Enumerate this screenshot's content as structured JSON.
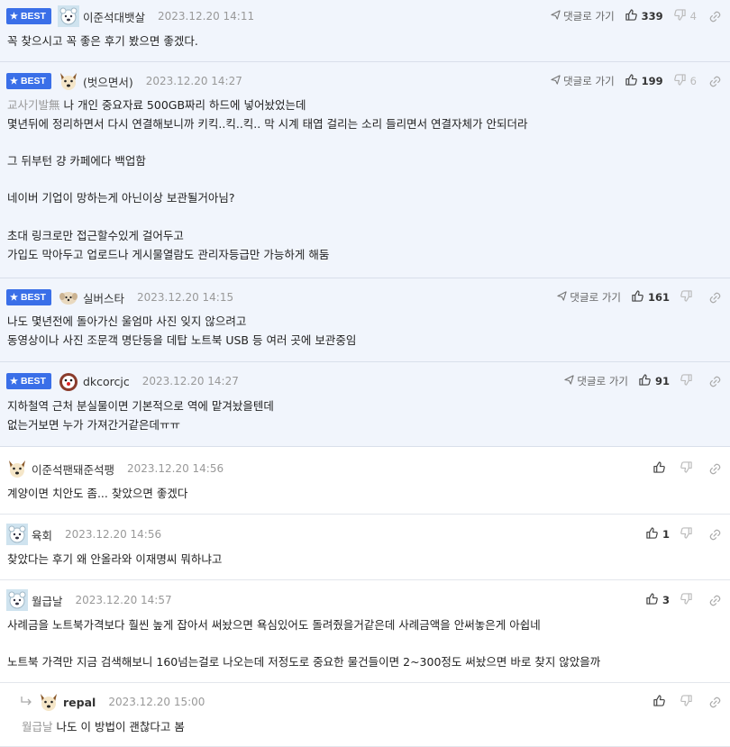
{
  "labels": {
    "best": "BEST",
    "reply": "댓글로 가기"
  },
  "colors": {
    "accent": "#3a6fe8",
    "best_bg": "#f1f5fc"
  },
  "comments": [
    {
      "best": true,
      "avatar": "polar-bear",
      "nick": "이준석대뱃살",
      "bold_nick": false,
      "date": "2023.12.20 14:11",
      "show_reply": true,
      "up": "339",
      "down": "4",
      "lines": [
        "꼭 찾으시고 꼭 좋은 후기 봤으면 좋겠다."
      ]
    },
    {
      "best": true,
      "avatar": "dog",
      "nick": "(벗으면서)",
      "bold_nick": false,
      "date": "2023.12.20 14:27",
      "show_reply": true,
      "up": "199",
      "down": "6",
      "mention": "교사기발無",
      "lines": [
        "나 개인 중요자료 500GB짜리 하드에 넣어놨었는데",
        "몇년뒤에 정리하면서 다시 연결해보니까 키킥..킥..킥.. 막 시계 태엽 걸리는 소리 들리면서 연결자체가 안되더라",
        "",
        "그 뒤부턴 걍 카페에다 백업함",
        "",
        "네이버 기업이 망하는게 아닌이상 보관될거아님?",
        "",
        "초대 링크로만 접근할수있게 걸어두고",
        "가입도 막아두고 업로드나 게시물열람도 관리자등급만 가능하게 해둠"
      ]
    },
    {
      "best": true,
      "avatar": "puppy",
      "nick": "실버스타",
      "bold_nick": false,
      "date": "2023.12.20 14:15",
      "show_reply": true,
      "up": "161",
      "down": "",
      "lines": [
        "나도 몇년전에 돌아가신 울엄마 사진 잊지 않으려고",
        "동영상이나 사진 조문객 명단등을 데탑 노트북 USB 등 여러 곳에 보관중임"
      ]
    },
    {
      "best": true,
      "avatar": "clown",
      "nick": "dkcorcjc",
      "bold_nick": false,
      "date": "2023.12.20 14:27",
      "show_reply": true,
      "up": "91",
      "down": "",
      "lines": [
        "지하철역 근처 분실물이면 기본적으로 역에 맡겨놨을텐데",
        "없는거보면 누가 가져간거같은데ㅠㅠ"
      ]
    },
    {
      "best": false,
      "avatar": "dog",
      "nick": "이준석팬돼준석팽",
      "bold_nick": false,
      "date": "2023.12.20 14:56",
      "show_reply": false,
      "up": "",
      "down": "",
      "lines": [
        "계양이면 치안도 좀... 찾았으면 좋겠다"
      ]
    },
    {
      "best": false,
      "avatar": "polar-bear",
      "nick": "육회",
      "bold_nick": false,
      "date": "2023.12.20 14:56",
      "show_reply": false,
      "up": "1",
      "down": "",
      "lines": [
        "찾았다는 후기 왜 안올라와 이재명씨 뭐하냐고"
      ]
    },
    {
      "best": false,
      "avatar": "polar-bear",
      "nick": "월급날",
      "bold_nick": false,
      "date": "2023.12.20 14:57",
      "show_reply": false,
      "up": "3",
      "down": "",
      "lines": [
        "사례금을 노트북가격보다 훨씬 높게 잡아서 써놨으면 욕심있어도 돌려줬을거같은데 사례금액을 안써놓은게 아쉽네",
        "",
        "노트북 가격만 지금 검색해보니 160넘는걸로 나오는데 저정도로 중요한 물건들이면 2~300정도 써놨으면 바로 찾지 않았을까"
      ]
    },
    {
      "best": false,
      "avatar": "dog",
      "nick": "repal",
      "bold_nick": true,
      "reply_child": true,
      "date": "2023.12.20 15:00",
      "show_reply": false,
      "up": "",
      "down": "",
      "mention": "월급날",
      "lines": [
        "나도 이 방법이 괜찮다고 봄"
      ]
    }
  ]
}
